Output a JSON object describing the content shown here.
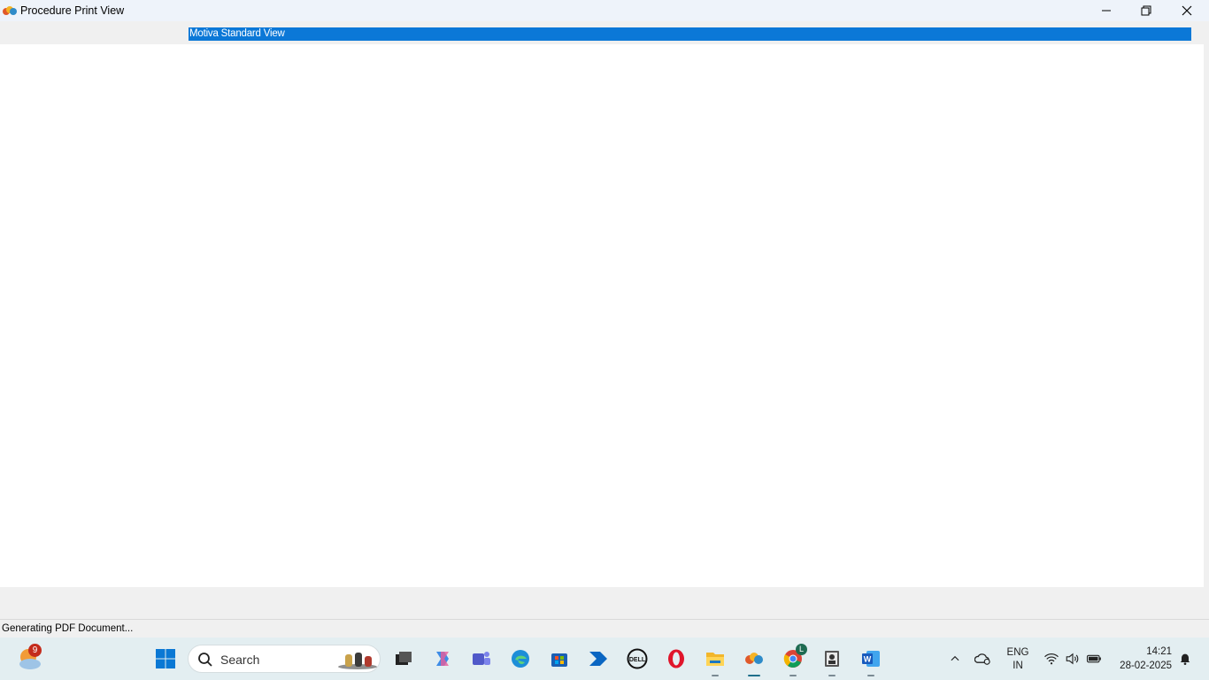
{
  "window": {
    "title": "Procedure Print View",
    "minimize_icon": "minimize-icon",
    "maximize_icon": "restore-icon",
    "close_icon": "close-icon"
  },
  "toolbar": {
    "view_selected": "Motiva Standard View",
    "highlight_color": "#0b78d7"
  },
  "status": {
    "text": "Generating PDF Document..."
  },
  "taskbar": {
    "weather_badge": "9",
    "search_placeholder": "Search",
    "apps": [
      "start-icon",
      "task-view-icon",
      "copilot-icon",
      "teams-icon",
      "edge-icon",
      "store-icon",
      "power-automate-icon",
      "dell-icon",
      "opera-icon",
      "file-explorer-icon",
      "motiva-app-icon",
      "chrome-icon",
      "contacts-icon",
      "word-icon"
    ],
    "chrome_badge": "L",
    "tray": {
      "lang_top": "ENG",
      "lang_bottom": "IN",
      "time": "14:21",
      "date": "28-02-2025"
    }
  }
}
